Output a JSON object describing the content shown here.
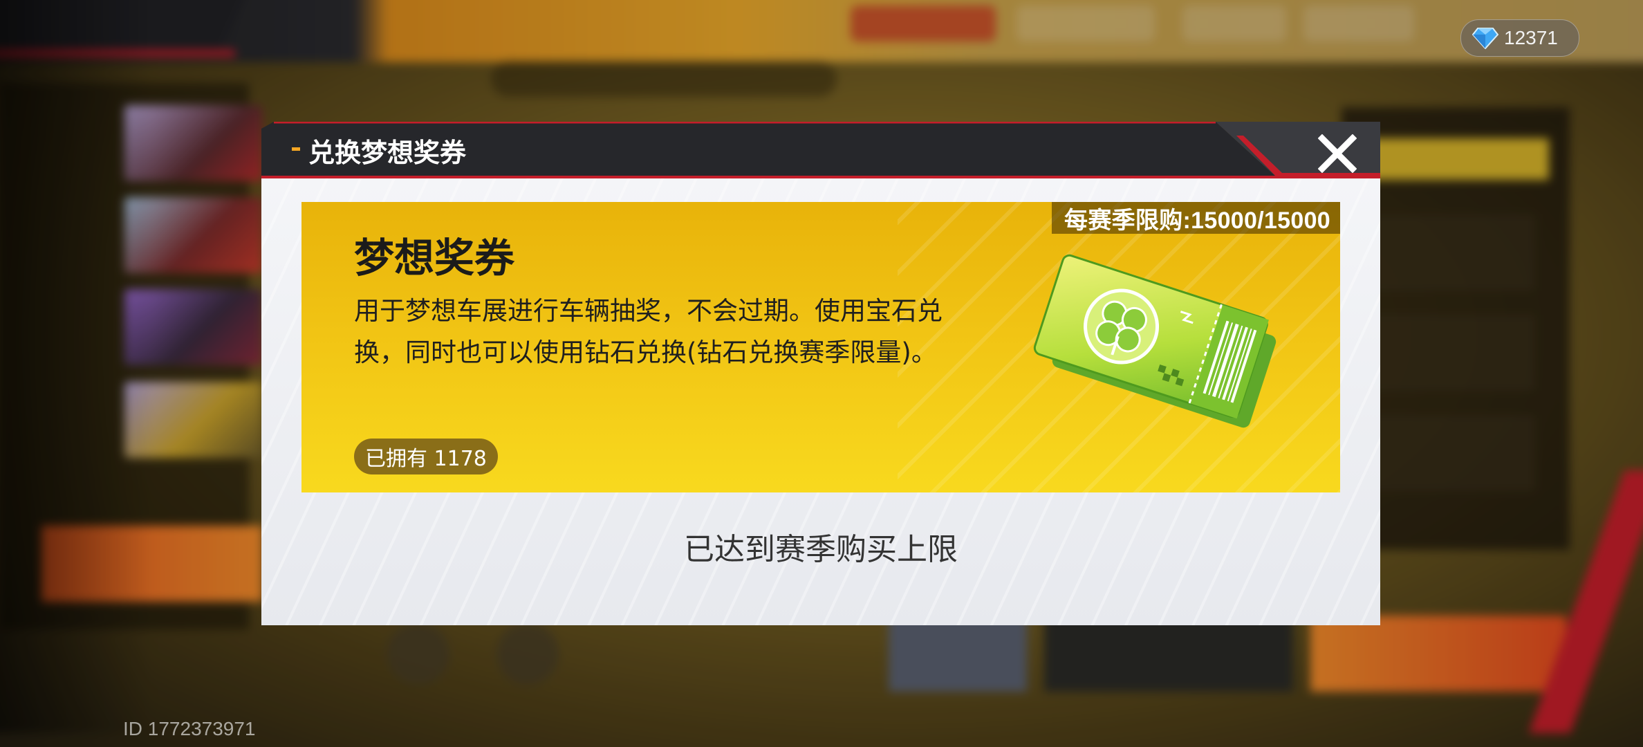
{
  "hud": {
    "gem_count": "12371",
    "user_id": "ID 1772373971"
  },
  "dialog": {
    "title": "兑换梦想奖券",
    "item": {
      "name": "梦想奖券",
      "description": "用于梦想车展进行车辆抽奖，不会过期。使用宝石兑换，同时也可以使用钻石兑换(钻石兑换赛季限量)。",
      "owned": "已拥有 1178",
      "limit": "每赛季限购:15000/15000",
      "icon": "lucky-clover-ticket-icon"
    },
    "status": "已达到赛季购买上限"
  },
  "colors": {
    "card_gold": "#f1c414",
    "header_dark": "#26272b",
    "accent_red": "#c41e2a",
    "accent_orange": "#f4a623"
  }
}
